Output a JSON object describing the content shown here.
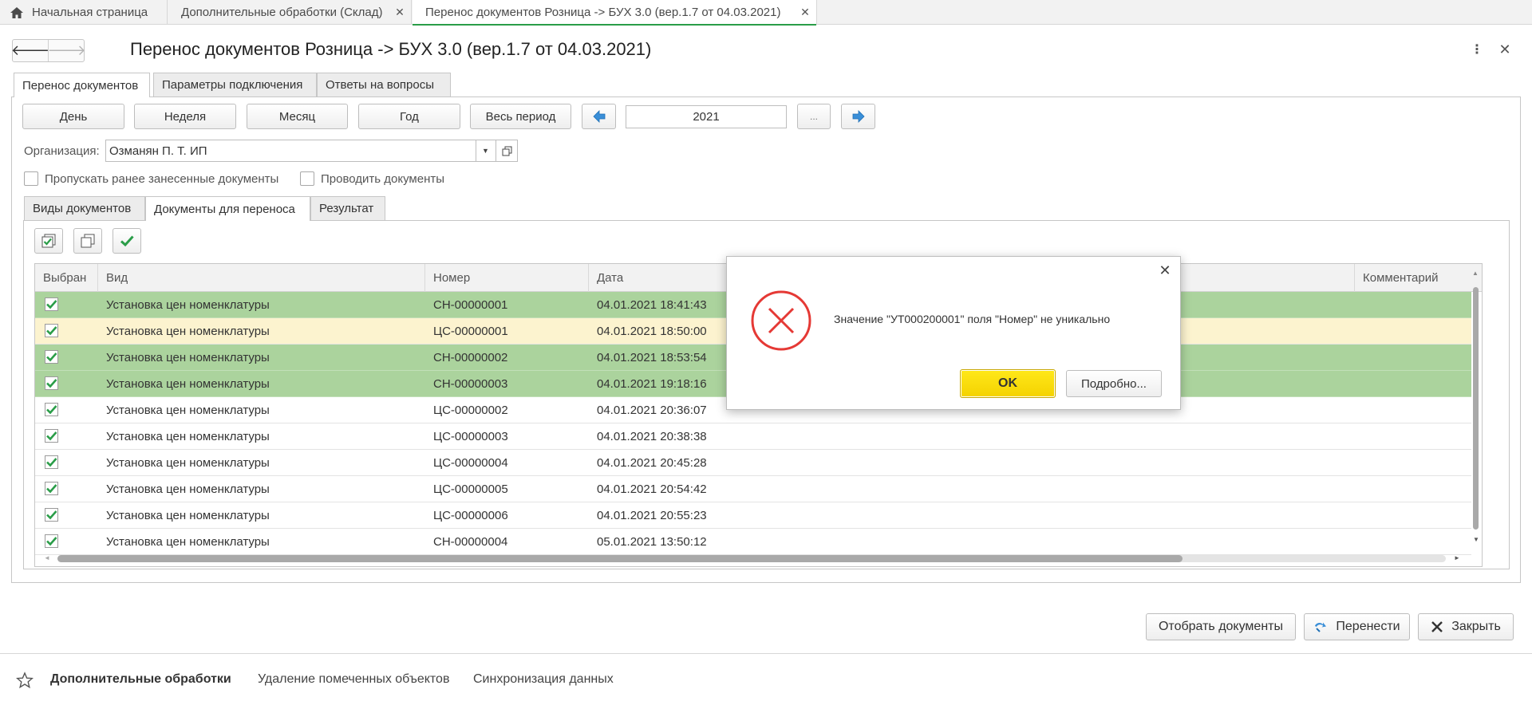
{
  "top_tabs": {
    "home": "Начальная страница",
    "items": [
      {
        "label": "Дополнительные обработки (Склад)",
        "active": false
      },
      {
        "label": "Перенос документов Розница -> БУХ 3.0 (вер.1.7 от 04.03.2021)",
        "active": true
      }
    ],
    "close_glyph": "✕"
  },
  "form": {
    "title": "Перенос документов Розница -> БУХ 3.0 (вер.1.7 от 04.03.2021)",
    "nav_back": "🡐",
    "nav_forward": "🡒",
    "more_glyph": "⋮",
    "close_glyph": "✕"
  },
  "main_tabs": [
    {
      "label": "Перенос документов",
      "active": true
    },
    {
      "label": "Параметры подключения",
      "active": false
    },
    {
      "label": "Ответы на вопросы",
      "active": false
    }
  ],
  "period": {
    "buttons": [
      "День",
      "Неделя",
      "Месяц",
      "Год",
      "Весь период"
    ],
    "year": "2021",
    "ellipsis": "..."
  },
  "organization": {
    "label": "Организация:",
    "value": "Озманян П. Т. ИП",
    "dropdown_glyph": "▼"
  },
  "options": {
    "skip_label": "Пропускать ранее занесенные документы",
    "post_label": "Проводить документы"
  },
  "inner_tabs": [
    {
      "label": "Виды документов",
      "active": false
    },
    {
      "label": "Документы для переноса",
      "active": true
    },
    {
      "label": "Результат",
      "active": false
    }
  ],
  "table": {
    "columns": [
      "Выбран",
      "Вид",
      "Номер",
      "Дата",
      "Комментарий"
    ],
    "rows": [
      {
        "checked": true,
        "type": "Установка цен номенклатуры",
        "number": "СН-00000001",
        "date": "04.01.2021 18:41:43",
        "comment": "",
        "highlight": "green"
      },
      {
        "checked": true,
        "type": "Установка цен номенклатуры",
        "number": "ЦС-00000001",
        "date": "04.01.2021 18:50:00",
        "comment": "",
        "highlight": "yellow"
      },
      {
        "checked": true,
        "type": "Установка цен номенклатуры",
        "number": "СН-00000002",
        "date": "04.01.2021 18:53:54",
        "comment": "",
        "highlight": "green"
      },
      {
        "checked": true,
        "type": "Установка цен номенклатуры",
        "number": "СН-00000003",
        "date": "04.01.2021 19:18:16",
        "comment": "",
        "highlight": "green"
      },
      {
        "checked": true,
        "type": "Установка цен номенклатуры",
        "number": "ЦС-00000002",
        "date": "04.01.2021 20:36:07",
        "comment": "",
        "highlight": "none"
      },
      {
        "checked": true,
        "type": "Установка цен номенклатуры",
        "number": "ЦС-00000003",
        "date": "04.01.2021 20:38:38",
        "comment": "",
        "highlight": "none"
      },
      {
        "checked": true,
        "type": "Установка цен номенклатуры",
        "number": "ЦС-00000004",
        "date": "04.01.2021 20:45:28",
        "comment": "",
        "highlight": "none"
      },
      {
        "checked": true,
        "type": "Установка цен номенклатуры",
        "number": "ЦС-00000005",
        "date": "04.01.2021 20:54:42",
        "comment": "",
        "highlight": "none"
      },
      {
        "checked": true,
        "type": "Установка цен номенклатуры",
        "number": "ЦС-00000006",
        "date": "04.01.2021 20:55:23",
        "comment": "",
        "highlight": "none"
      },
      {
        "checked": true,
        "type": "Установка цен номенклатуры",
        "number": "СН-00000004",
        "date": "05.01.2021 13:50:12",
        "comment": "",
        "highlight": "none"
      }
    ]
  },
  "actions": {
    "select_documents": "Отобрать документы",
    "transfer": "Перенести",
    "close": "Закрыть"
  },
  "footer": {
    "links": [
      "Дополнительные обработки",
      "Удаление помеченных объектов",
      "Синхронизация данных"
    ]
  },
  "dialog": {
    "message": "Значение \"УТ000200001\" поля \"Номер\" не уникально",
    "ok_label": "OK",
    "details_label": "Подробно...",
    "close_glyph": "✕"
  },
  "colors": {
    "accent_green": "#2a9d48",
    "row_green": "#abd39d",
    "row_yellow": "#fcf3cf",
    "ok_yellow": "#f4d200",
    "error_red": "#e53935",
    "arrow_blue": "#3a8fd8"
  }
}
